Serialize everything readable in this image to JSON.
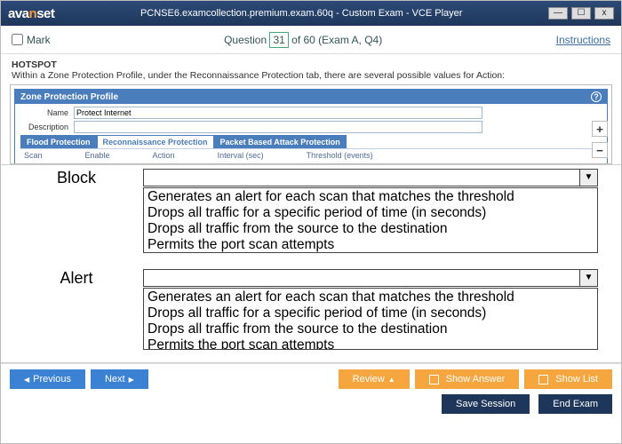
{
  "title": {
    "brand_prefix": "ava",
    "brand_mid": "n",
    "brand_suffix": "set",
    "text": "PCNSE6.examcollection.premium.exam.60q - Custom Exam - VCE Player"
  },
  "win_controls": {
    "min": "—",
    "max": "☐",
    "close": "x"
  },
  "qbar": {
    "mark": "Mark",
    "question_word": "Question",
    "q_num": "31",
    "of_text": " of 60 (Exam A, Q4)",
    "instructions": "Instructions"
  },
  "prompt": {
    "header": "HOTSPOT",
    "body": "Within a Zone Protection Profile, under the Reconnaissance Protection tab, there are several possible values for Action:"
  },
  "zpp": {
    "title": "Zone Protection Profile",
    "name_lbl": "Name",
    "name_val": "Protect Internet",
    "desc_lbl": "Description",
    "tabs": [
      "Flood Protection",
      "Reconnaissance Protection",
      "Packet Based Attack Protection"
    ],
    "cols": [
      "Scan",
      "Enable",
      "Action",
      "Interval (sec)",
      "Threshold (events)"
    ]
  },
  "zoom": {
    "in": "+",
    "out": "−"
  },
  "options": {
    "items": [
      "Generates an alert for each scan that matches the threshold",
      "Drops all traffic for a specific period of time (in seconds)",
      "Drops all traffic from the source to the destination",
      "Permits the port scan attempts"
    ],
    "labels": {
      "block": "Block",
      "alert": "Alert"
    }
  },
  "footer": {
    "previous": "Previous",
    "next": "Next",
    "review": "Review",
    "show_answer": "Show Answer",
    "show_list": "Show List",
    "save_session": "Save Session",
    "end_exam": "End Exam"
  }
}
